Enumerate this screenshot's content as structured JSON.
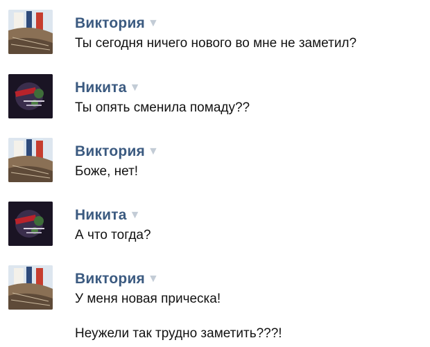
{
  "messages": [
    {
      "author": "Виктория",
      "lines": [
        "Ты сегодня ничего нового во мне не заметил?"
      ]
    },
    {
      "author": "Никита",
      "lines": [
        "Ты опять сменила помаду??"
      ]
    },
    {
      "author": "Виктория",
      "lines": [
        "Боже, нет!"
      ]
    },
    {
      "author": "Никита",
      "lines": [
        "А что тогда?"
      ]
    },
    {
      "author": "Виктория",
      "lines": [
        "У меня новая прическа!",
        "Неужели так трудно заметить???!"
      ]
    }
  ],
  "icons": {
    "avatar_viktoria": "book-photo-avatar",
    "avatar_nikita": "dark-logo-avatar",
    "author_menu": "triangle-down-icon"
  },
  "colors": {
    "author_name": "#3b5a80",
    "text": "#111111",
    "arrow": "#c3ccd6"
  }
}
